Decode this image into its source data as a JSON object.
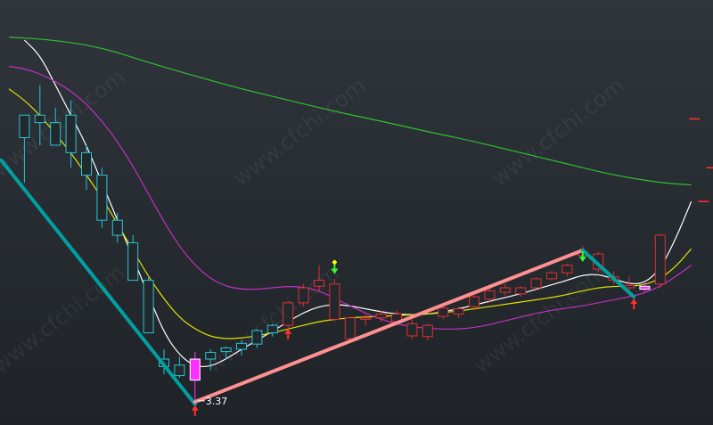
{
  "chart_data": {
    "type": "candlestick",
    "low_label": "3.37",
    "price_axis": {
      "value_at_top": 8.2,
      "value_at_bottom": 3.25
    },
    "candles": [
      {
        "i": 1,
        "o": 6.9,
        "h": 7.2,
        "l": 6.3,
        "c": 7.2,
        "color": "cyan"
      },
      {
        "i": 2,
        "o": 7.1,
        "h": 7.6,
        "l": 6.8,
        "c": 7.2,
        "color": "cyan"
      },
      {
        "i": 3,
        "o": 7.1,
        "h": 7.3,
        "l": 6.8,
        "c": 6.8,
        "color": "cyan"
      },
      {
        "i": 4,
        "o": 7.2,
        "h": 7.4,
        "l": 6.5,
        "c": 6.7,
        "color": "cyan"
      },
      {
        "i": 5,
        "o": 6.7,
        "h": 6.8,
        "l": 6.2,
        "c": 6.4,
        "color": "cyan"
      },
      {
        "i": 6,
        "o": 6.4,
        "h": 6.5,
        "l": 5.7,
        "c": 5.8,
        "color": "cyan"
      },
      {
        "i": 7,
        "o": 5.8,
        "h": 5.9,
        "l": 5.5,
        "c": 5.6,
        "color": "cyan"
      },
      {
        "i": 8,
        "o": 5.5,
        "h": 5.6,
        "l": 5.0,
        "c": 5.0,
        "color": "cyan"
      },
      {
        "i": 9,
        "o": 5.0,
        "h": 5.05,
        "l": 4.3,
        "c": 4.3,
        "color": "cyan"
      },
      {
        "i": 10,
        "o": 3.95,
        "h": 4.08,
        "l": 3.75,
        "c": 3.85,
        "color": "cyan"
      },
      {
        "i": 11,
        "o": 3.87,
        "h": 3.98,
        "l": 3.7,
        "c": 3.73,
        "color": "cyan"
      },
      {
        "i": 12,
        "o": 3.95,
        "h": 4.05,
        "l": 3.37,
        "c": 3.67,
        "color": "magenta"
      },
      {
        "i": 13,
        "o": 3.95,
        "h": 4.08,
        "l": 3.8,
        "c": 4.04,
        "color": "cyan"
      },
      {
        "i": 14,
        "o": 4.05,
        "h": 4.12,
        "l": 3.95,
        "c": 4.1,
        "color": "cyan"
      },
      {
        "i": 15,
        "o": 4.08,
        "h": 4.2,
        "l": 4.0,
        "c": 4.16,
        "color": "cyan"
      },
      {
        "i": 16,
        "o": 4.15,
        "h": 4.35,
        "l": 4.1,
        "c": 4.33,
        "color": "cyan"
      },
      {
        "i": 17,
        "o": 4.3,
        "h": 4.42,
        "l": 4.25,
        "c": 4.4,
        "color": "cyan"
      },
      {
        "i": 18,
        "o": 4.4,
        "h": 4.72,
        "l": 4.35,
        "c": 4.7,
        "color": "red"
      },
      {
        "i": 19,
        "o": 4.7,
        "h": 4.95,
        "l": 4.65,
        "c": 4.9,
        "color": "red"
      },
      {
        "i": 20,
        "o": 4.92,
        "h": 5.2,
        "l": 4.85,
        "c": 5.0,
        "color": "red"
      },
      {
        "i": 21,
        "o": 4.95,
        "h": 5.02,
        "l": 4.45,
        "c": 4.48,
        "color": "red"
      },
      {
        "i": 22,
        "o": 4.5,
        "h": 4.52,
        "l": 4.18,
        "c": 4.22,
        "color": "red"
      },
      {
        "i": 23,
        "o": 4.48,
        "h": 4.55,
        "l": 4.4,
        "c": 4.5,
        "color": "red"
      },
      {
        "i": 24,
        "o": 4.5,
        "h": 4.6,
        "l": 4.45,
        "c": 4.55,
        "color": "red"
      },
      {
        "i": 25,
        "o": 4.55,
        "h": 4.6,
        "l": 4.4,
        "c": 4.45,
        "color": "red"
      },
      {
        "i": 26,
        "o": 4.42,
        "h": 4.48,
        "l": 4.22,
        "c": 4.26,
        "color": "red"
      },
      {
        "i": 27,
        "o": 4.25,
        "h": 4.42,
        "l": 4.2,
        "c": 4.4,
        "color": "red"
      },
      {
        "i": 28,
        "o": 4.52,
        "h": 4.66,
        "l": 4.48,
        "c": 4.63,
        "color": "red"
      },
      {
        "i": 29,
        "o": 4.55,
        "h": 4.65,
        "l": 4.5,
        "c": 4.62,
        "color": "red"
      },
      {
        "i": 30,
        "o": 4.65,
        "h": 4.8,
        "l": 4.6,
        "c": 4.78,
        "color": "red"
      },
      {
        "i": 31,
        "o": 4.75,
        "h": 4.92,
        "l": 4.7,
        "c": 4.86,
        "color": "red"
      },
      {
        "i": 32,
        "o": 4.84,
        "h": 4.95,
        "l": 4.8,
        "c": 4.9,
        "color": "red"
      },
      {
        "i": 33,
        "o": 4.82,
        "h": 4.92,
        "l": 4.78,
        "c": 4.9,
        "color": "red"
      },
      {
        "i": 34,
        "o": 4.9,
        "h": 5.04,
        "l": 4.88,
        "c": 5.02,
        "color": "red"
      },
      {
        "i": 35,
        "o": 5.02,
        "h": 5.12,
        "l": 5.0,
        "c": 5.1,
        "color": "red"
      },
      {
        "i": 36,
        "o": 5.1,
        "h": 5.22,
        "l": 5.05,
        "c": 5.2,
        "color": "red"
      },
      {
        "i": 37,
        "o": 5.38,
        "h": 5.46,
        "l": 5.3,
        "c": 5.33,
        "color": "red"
      },
      {
        "i": 38,
        "o": 5.35,
        "h": 5.38,
        "l": 5.1,
        "c": 5.15,
        "color": "red"
      },
      {
        "i": 39,
        "o": 5.05,
        "h": 5.12,
        "l": 4.95,
        "c": 5.0,
        "color": "red"
      },
      {
        "i": 40,
        "o": 4.93,
        "h": 5.05,
        "l": 4.8,
        "c": 4.9,
        "color": "red"
      },
      {
        "i": 41,
        "o": 4.88,
        "h": 4.98,
        "l": 4.85,
        "c": 4.92,
        "color": "magenta"
      },
      {
        "i": 42,
        "o": 4.95,
        "h": 5.62,
        "l": 4.9,
        "c": 5.6,
        "color": "red"
      }
    ],
    "moving_averages": [
      {
        "color": "#ffffff",
        "points": [
          [
            1,
            8.2
          ],
          [
            2,
            8.0
          ],
          [
            3,
            7.6
          ],
          [
            4,
            7.2
          ],
          [
            5,
            6.8
          ],
          [
            6,
            6.3
          ],
          [
            7,
            5.8
          ],
          [
            8,
            5.3
          ],
          [
            9,
            4.8
          ],
          [
            10,
            4.3
          ],
          [
            11,
            4.0
          ],
          [
            12,
            3.85
          ],
          [
            13,
            3.85
          ],
          [
            14,
            3.95
          ],
          [
            15,
            4.08
          ],
          [
            16,
            4.2
          ],
          [
            17,
            4.32
          ],
          [
            18,
            4.45
          ],
          [
            19,
            4.57
          ],
          [
            20,
            4.65
          ],
          [
            21,
            4.68
          ],
          [
            22,
            4.66
          ],
          [
            23,
            4.62
          ],
          [
            24,
            4.58
          ],
          [
            25,
            4.55
          ],
          [
            26,
            4.54
          ],
          [
            27,
            4.55
          ],
          [
            28,
            4.58
          ],
          [
            29,
            4.62
          ],
          [
            30,
            4.67
          ],
          [
            31,
            4.72
          ],
          [
            32,
            4.77
          ],
          [
            33,
            4.82
          ],
          [
            34,
            4.88
          ],
          [
            35,
            4.94
          ],
          [
            36,
            5.0
          ],
          [
            37,
            5.07
          ],
          [
            38,
            5.08
          ],
          [
            39,
            5.02
          ],
          [
            40,
            4.95
          ],
          [
            41,
            4.96
          ],
          [
            42,
            5.15
          ],
          [
            43,
            5.55
          ],
          [
            44,
            6.05
          ]
        ]
      },
      {
        "color": "#e0e000",
        "points": [
          [
            0,
            7.55
          ],
          [
            1,
            7.4
          ],
          [
            2,
            7.2
          ],
          [
            3,
            6.95
          ],
          [
            4,
            6.7
          ],
          [
            5,
            6.4
          ],
          [
            6,
            6.1
          ],
          [
            7,
            5.75
          ],
          [
            8,
            5.4
          ],
          [
            9,
            5.05
          ],
          [
            10,
            4.75
          ],
          [
            11,
            4.5
          ],
          [
            12,
            4.35
          ],
          [
            13,
            4.25
          ],
          [
            14,
            4.22
          ],
          [
            15,
            4.23
          ],
          [
            16,
            4.26
          ],
          [
            17,
            4.3
          ],
          [
            18,
            4.35
          ],
          [
            19,
            4.4
          ],
          [
            20,
            4.45
          ],
          [
            21,
            4.48
          ],
          [
            22,
            4.5
          ],
          [
            23,
            4.51
          ],
          [
            24,
            4.52
          ],
          [
            25,
            4.53
          ],
          [
            26,
            4.54
          ],
          [
            27,
            4.55
          ],
          [
            28,
            4.57
          ],
          [
            29,
            4.59
          ],
          [
            30,
            4.62
          ],
          [
            31,
            4.65
          ],
          [
            32,
            4.68
          ],
          [
            33,
            4.71
          ],
          [
            34,
            4.74
          ],
          [
            35,
            4.77
          ],
          [
            36,
            4.81
          ],
          [
            37,
            4.86
          ],
          [
            38,
            4.9
          ],
          [
            39,
            4.92
          ],
          [
            40,
            4.92
          ],
          [
            41,
            4.94
          ],
          [
            42,
            5.02
          ],
          [
            43,
            5.18
          ],
          [
            44,
            5.42
          ]
        ]
      },
      {
        "color": "#c030c0",
        "points": [
          [
            0,
            7.85
          ],
          [
            1,
            7.82
          ],
          [
            2,
            7.75
          ],
          [
            3,
            7.65
          ],
          [
            4,
            7.52
          ],
          [
            5,
            7.35
          ],
          [
            6,
            7.12
          ],
          [
            7,
            6.85
          ],
          [
            8,
            6.52
          ],
          [
            9,
            6.15
          ],
          [
            10,
            5.78
          ],
          [
            11,
            5.45
          ],
          [
            12,
            5.2
          ],
          [
            13,
            5.02
          ],
          [
            14,
            4.92
          ],
          [
            15,
            4.88
          ],
          [
            16,
            4.88
          ],
          [
            17,
            4.9
          ],
          [
            18,
            4.92
          ],
          [
            19,
            4.91
          ],
          [
            20,
            4.86
          ],
          [
            21,
            4.76
          ],
          [
            22,
            4.66
          ],
          [
            23,
            4.56
          ],
          [
            24,
            4.48
          ],
          [
            25,
            4.42
          ],
          [
            26,
            4.38
          ],
          [
            27,
            4.36
          ],
          [
            28,
            4.35
          ],
          [
            29,
            4.35
          ],
          [
            30,
            4.37
          ],
          [
            31,
            4.41
          ],
          [
            32,
            4.46
          ],
          [
            33,
            4.51
          ],
          [
            34,
            4.56
          ],
          [
            35,
            4.6
          ],
          [
            36,
            4.63
          ],
          [
            37,
            4.66
          ],
          [
            38,
            4.7
          ],
          [
            39,
            4.74
          ],
          [
            40,
            4.78
          ],
          [
            41,
            4.83
          ],
          [
            42,
            4.92
          ],
          [
            43,
            5.05
          ],
          [
            44,
            5.2
          ]
        ]
      },
      {
        "color": "#30c030",
        "points": [
          [
            0,
            8.24
          ],
          [
            3,
            8.2
          ],
          [
            6,
            8.1
          ],
          [
            9,
            7.9
          ],
          [
            12,
            7.72
          ],
          [
            15,
            7.55
          ],
          [
            18,
            7.4
          ],
          [
            21,
            7.25
          ],
          [
            24,
            7.12
          ],
          [
            27,
            6.98
          ],
          [
            30,
            6.85
          ],
          [
            33,
            6.7
          ],
          [
            36,
            6.55
          ],
          [
            39,
            6.4
          ],
          [
            42,
            6.3
          ],
          [
            44,
            6.27
          ]
        ]
      }
    ],
    "trend_lines": [
      {
        "color": "#00a0a0",
        "from": [
          -0.5,
          6.6
        ],
        "to": [
          12,
          3.35
        ]
      },
      {
        "color": "#ff9090",
        "from": [
          12,
          3.38
        ],
        "to": [
          37,
          5.4
        ]
      },
      {
        "color": "#00a0a0",
        "from": [
          37,
          5.4
        ],
        "to": [
          40.3,
          4.78
        ]
      }
    ],
    "signals": [
      {
        "type": "up-arrow",
        "color": "#ff3030",
        "i": 12,
        "price": 3.3
      },
      {
        "type": "up-arrow",
        "color": "#ff3030",
        "i": 18,
        "price": 4.32
      },
      {
        "type": "down-arrow",
        "color": "#30ff30",
        "i": 21,
        "price": 5.12
      },
      {
        "type": "diamond",
        "color": "#ffff00",
        "i": 21,
        "price": 5.24
      },
      {
        "type": "down-arrow",
        "color": "#30ff30",
        "i": 37,
        "price": 5.28
      },
      {
        "type": "up-arrow",
        "color": "#ff3030",
        "i": 40.3,
        "price": 4.72
      }
    ],
    "overlay_marks": [
      {
        "color": "#ff3030",
        "i": 46,
        "price": 8.0,
        "type": "stop"
      },
      {
        "color": "#ff3030",
        "i": 46,
        "price": 7.72,
        "type": "bar"
      },
      {
        "color": "#ff3030",
        "i": 45.3,
        "price": 6.5,
        "type": "dash"
      },
      {
        "color": "#ff3030",
        "i": 44.2,
        "price": 7.15,
        "type": "dash"
      },
      {
        "color": "#ff3030",
        "i": 44.8,
        "price": 6.05,
        "type": "dash"
      }
    ],
    "watermark_text": "www.cfchi.com"
  }
}
